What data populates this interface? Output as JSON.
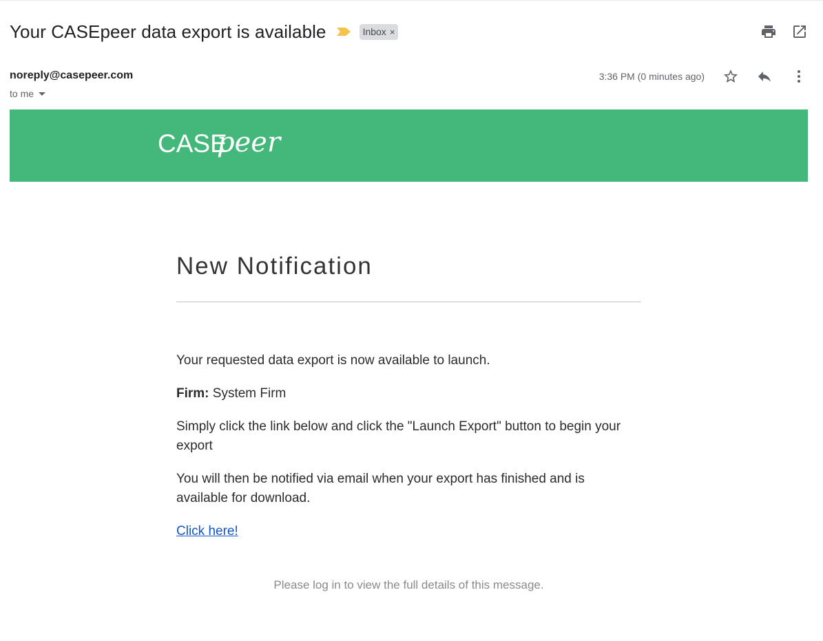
{
  "email": {
    "subject": "Your CASEpeer data export is available",
    "label_chip": "Inbox",
    "label_chip_close": "×",
    "sender": "noreply@casepeer.com",
    "recipient": "to me",
    "timestamp": "3:36 PM (0 minutes ago)"
  },
  "icons": {
    "importance": "importance-marker-icon",
    "print": "print-icon",
    "open_new_window": "open-in-new-window-icon",
    "star": "star-icon",
    "reply": "reply-icon",
    "more": "more-vertical-icon",
    "recipient_dropdown": "chevron-down-icon"
  },
  "banner": {
    "brand": "CASEpeer",
    "brand_caps": "CASE",
    "brand_script": "peer",
    "background_color": "#44b87b"
  },
  "message": {
    "heading": "New Notification",
    "intro": "Your requested data export is now available to launch.",
    "firm_label": "Firm:",
    "firm_value": " System Firm",
    "instructions": "Simply click the link below and click the \"Launch Export\" button to begin your export",
    "followup": "You will then be notified via email when your export has finished and is available for download.",
    "link_text": "Click here!",
    "footer": "Please log in to view the full details of this message."
  },
  "colors": {
    "importance_marker": "#f6c34a",
    "link": "#1155cc",
    "muted": "#5f6368"
  }
}
